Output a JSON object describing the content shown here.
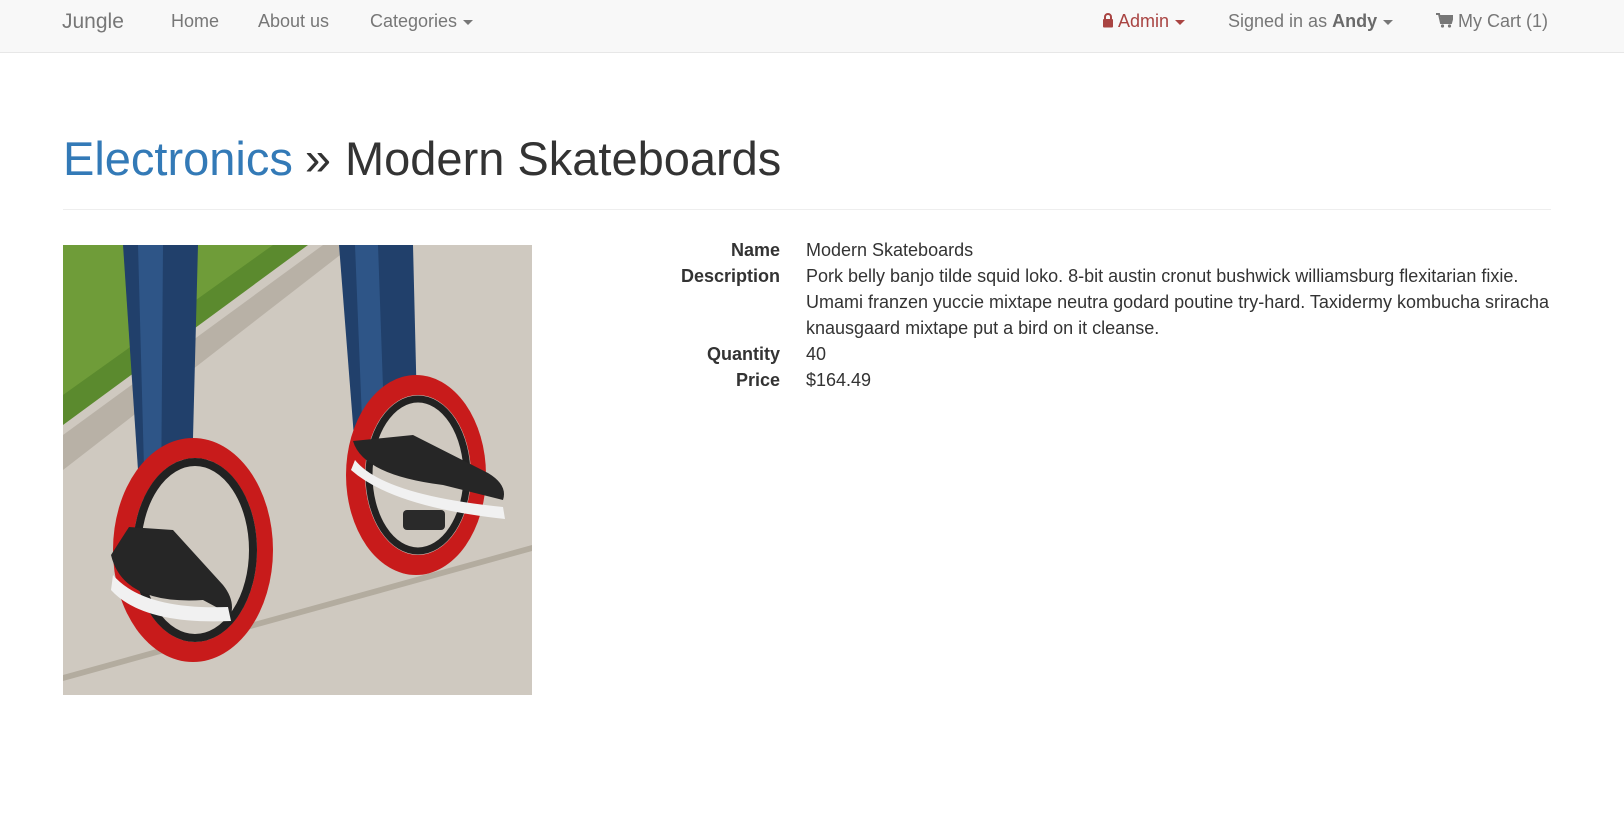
{
  "nav": {
    "brand": "Jungle",
    "home": "Home",
    "about": "About us",
    "categories": "Categories",
    "admin": "Admin",
    "signed_in_prefix": "Signed in as",
    "user": "Andy",
    "cart": "My Cart (1)",
    "icons": {
      "admin": "lock-icon",
      "cart": "shopping-cart-icon"
    },
    "colors": {
      "admin": "#a94442",
      "link": "#337ab7"
    }
  },
  "header": {
    "category": "Electronics",
    "separator": "»",
    "product": "Modern Skateboards"
  },
  "product": {
    "image_alt": "Modern Skateboards",
    "fields": [
      {
        "label": "Name",
        "value": "Modern Skateboards"
      },
      {
        "label": "Description",
        "value": "Pork belly banjo tilde squid loko. 8-bit austin cronut bushwick williamsburg flexitarian fixie. Umami franzen yuccie mixtape neutra godard poutine try-hard. Taxidermy kombucha sriracha knausgaard mixtape put a bird on it cleanse."
      },
      {
        "label": "Quantity",
        "value": "40"
      },
      {
        "label": "Price",
        "value": "$164.49"
      }
    ]
  }
}
